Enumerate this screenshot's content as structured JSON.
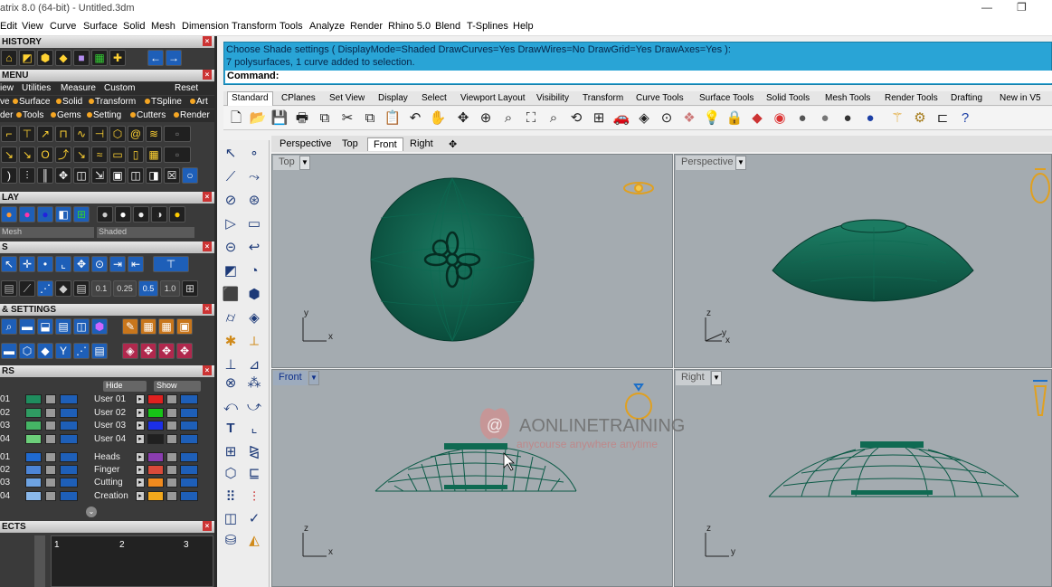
{
  "window": {
    "title": "atrix 8.0 (64-bit) - Untitled.3dm",
    "minimize": "—",
    "restore": "❐"
  },
  "menu": [
    "Edit",
    "View",
    "Curve",
    "Surface",
    "Solid",
    "Mesh",
    "Dimension",
    "Transform",
    "Tools",
    "Analyze",
    "Render",
    "Rhino 5.0",
    "Blend",
    "T-Splines",
    "Help"
  ],
  "panels": {
    "history": "HISTORY",
    "menu": "MENU",
    "lay": "LAY",
    "s": "S",
    "settings": "& SETTINGS",
    "rs": "RS",
    "ects": "ECTS",
    "menu_tabs": [
      "iew",
      "Utilities",
      "Measure",
      "Custom",
      "Reset"
    ],
    "menu_row2": [
      "ve",
      "Surface",
      "Solid",
      "Transform",
      "TSpline",
      "Art"
    ],
    "menu_row3": [
      "der",
      "Tools",
      "Gems",
      "Setting",
      "Cutters",
      "Render"
    ],
    "display_left": "Mesh",
    "display_right": "Shaded",
    "snap_values": [
      "0.1",
      "0.25",
      "0.5",
      "1.0"
    ],
    "layer_buttons": {
      "hide": "Hide",
      "show": "Show"
    },
    "layers_left": [
      "01",
      "02",
      "03",
      "04",
      "01",
      "02",
      "03",
      "04"
    ],
    "layers_right": [
      {
        "name": "User 01",
        "color": "#e0201f"
      },
      {
        "name": "User 02",
        "color": "#17c417"
      },
      {
        "name": "User 03",
        "color": "#1b2fe8"
      },
      {
        "name": "User 04",
        "color": "#202020"
      },
      {
        "name": "Heads",
        "color": "#8a3db0"
      },
      {
        "name": "Finger",
        "color": "#d94a3a"
      },
      {
        "name": "Cutting",
        "color": "#f08a1e"
      },
      {
        "name": "Creation",
        "color": "#f2a81c"
      }
    ],
    "objects_cols": [
      "1",
      "2",
      "3"
    ]
  },
  "command": {
    "line1": "Choose Shade settings ( DisplayMode=Shaded  DrawCurves=Yes  DrawWires=No  DrawGrid=Yes  DrawAxes=Yes ):",
    "line2": "7 polysurfaces, 1 curve added to selection.",
    "prompt": "Command:"
  },
  "tool_tabs": [
    "Standard",
    "CPlanes",
    "Set View",
    "Display",
    "Select",
    "Viewport Layout",
    "Visibility",
    "Transform",
    "Curve Tools",
    "Surface Tools",
    "Solid Tools",
    "Mesh Tools",
    "Render Tools",
    "Drafting",
    "New in V5"
  ],
  "viewport_tabs": [
    "Perspective",
    "Top",
    "Front",
    "Right",
    "✥"
  ],
  "viewports": {
    "top": {
      "label": "Top",
      "axes": [
        "y",
        "x"
      ]
    },
    "perspective": {
      "label": "Perspective",
      "axes": [
        "z",
        "y",
        "x"
      ]
    },
    "front": {
      "label": "Front",
      "axes": [
        "z",
        "x"
      ]
    },
    "right": {
      "label": "Right",
      "axes": [
        "z",
        "y"
      ]
    }
  },
  "watermark": {
    "brand": "AONLINETRAINING",
    "tagline": "anycourse anywhere anytime"
  },
  "colors": {
    "model": "#0f5a48",
    "viewport_bg": "#a4abb0",
    "command_bg": "#29a4d6",
    "accent": "#0d2e8a"
  }
}
